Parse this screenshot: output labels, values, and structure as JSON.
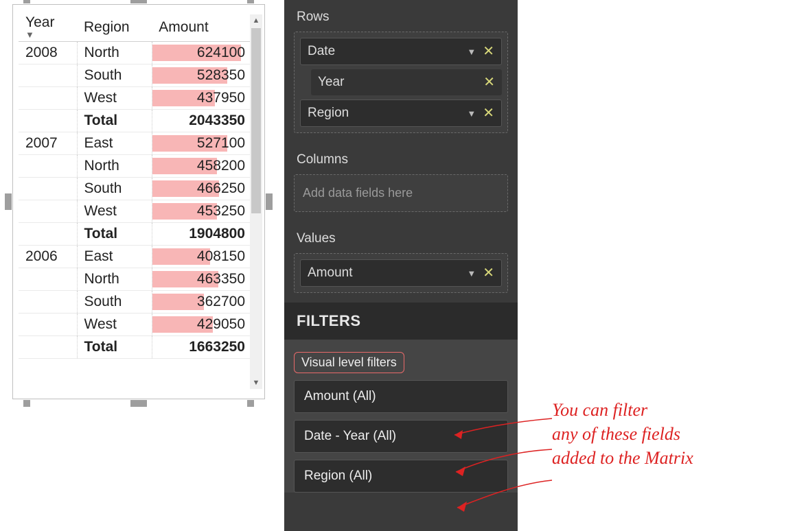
{
  "matrix": {
    "headers": {
      "year": "Year",
      "region": "Region",
      "amount": "Amount"
    },
    "sort_indicator": "▼",
    "max_amount": 700000,
    "groups": [
      {
        "year": "2008",
        "rows": [
          {
            "region": "North",
            "amount": 624100
          },
          {
            "region": "South",
            "amount": 528350
          },
          {
            "region": "West",
            "amount": 437950
          }
        ],
        "total_label": "Total",
        "total_amount": 2043350
      },
      {
        "year": "2007",
        "rows": [
          {
            "region": "East",
            "amount": 527100
          },
          {
            "region": "North",
            "amount": 458200
          },
          {
            "region": "South",
            "amount": 466250
          },
          {
            "region": "West",
            "amount": 453250
          }
        ],
        "total_label": "Total",
        "total_amount": 1904800
      },
      {
        "year": "2006",
        "rows": [
          {
            "region": "East",
            "amount": 408150
          },
          {
            "region": "North",
            "amount": 463350
          },
          {
            "region": "South",
            "amount": 362700
          },
          {
            "region": "West",
            "amount": 429050
          }
        ],
        "total_label": "Total",
        "total_amount": 1663250
      }
    ]
  },
  "pane": {
    "rows_label": "Rows",
    "rows_fields": [
      {
        "label": "Date",
        "has_chevron": true,
        "has_close": true,
        "children": [
          {
            "label": "Year",
            "has_close": true
          }
        ]
      },
      {
        "label": "Region",
        "has_chevron": true,
        "has_close": true
      }
    ],
    "columns_label": "Columns",
    "columns_placeholder": "Add data fields here",
    "values_label": "Values",
    "values_fields": [
      {
        "label": "Amount",
        "has_chevron": true,
        "has_close": true
      }
    ],
    "filters_heading": "FILTERS",
    "visual_level_filters_label": "Visual level filters",
    "filter_items": [
      {
        "label": "Amount (All)"
      },
      {
        "label": "Date - Year (All)"
      },
      {
        "label": "Region (All)"
      }
    ]
  },
  "annotation": {
    "line1": "You can filter",
    "line2": "any of these fields",
    "line3": "added to the Matrix"
  }
}
